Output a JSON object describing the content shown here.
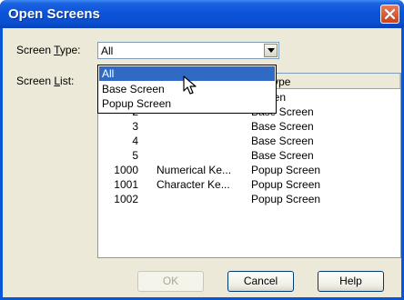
{
  "window": {
    "title": "Open Screens"
  },
  "screen_type": {
    "label_prefix": "Screen ",
    "label_accel": "T",
    "label_rest": "ype:",
    "value": "All"
  },
  "screen_list": {
    "label_prefix": "Screen ",
    "label_accel": "L",
    "label_rest": "ist:"
  },
  "list": {
    "header_visible_text": "en Type",
    "rows": [
      {
        "number": "",
        "name": "",
        "type": "Screen"
      },
      {
        "number": "2",
        "name": "",
        "type": "Base Screen"
      },
      {
        "number": "3",
        "name": "",
        "type": "Base Screen"
      },
      {
        "number": "4",
        "name": "",
        "type": "Base Screen"
      },
      {
        "number": "5",
        "name": "",
        "type": "Base Screen"
      },
      {
        "number": "1000",
        "name": "Numerical Ke...",
        "type": "Popup Screen"
      },
      {
        "number": "1001",
        "name": "Character Ke...",
        "type": "Popup Screen"
      },
      {
        "number": "1002",
        "name": "",
        "type": "Popup Screen"
      }
    ]
  },
  "dropdown": {
    "options": [
      "All",
      "Base Screen",
      "Popup Screen"
    ],
    "selected": "All"
  },
  "buttons": {
    "ok": "OK",
    "cancel": "Cancel",
    "help": "Help"
  },
  "icons": {
    "close": "close-icon",
    "dropdown_arrow": "chevron-down-icon",
    "cursor": "mouse-pointer-icon"
  }
}
